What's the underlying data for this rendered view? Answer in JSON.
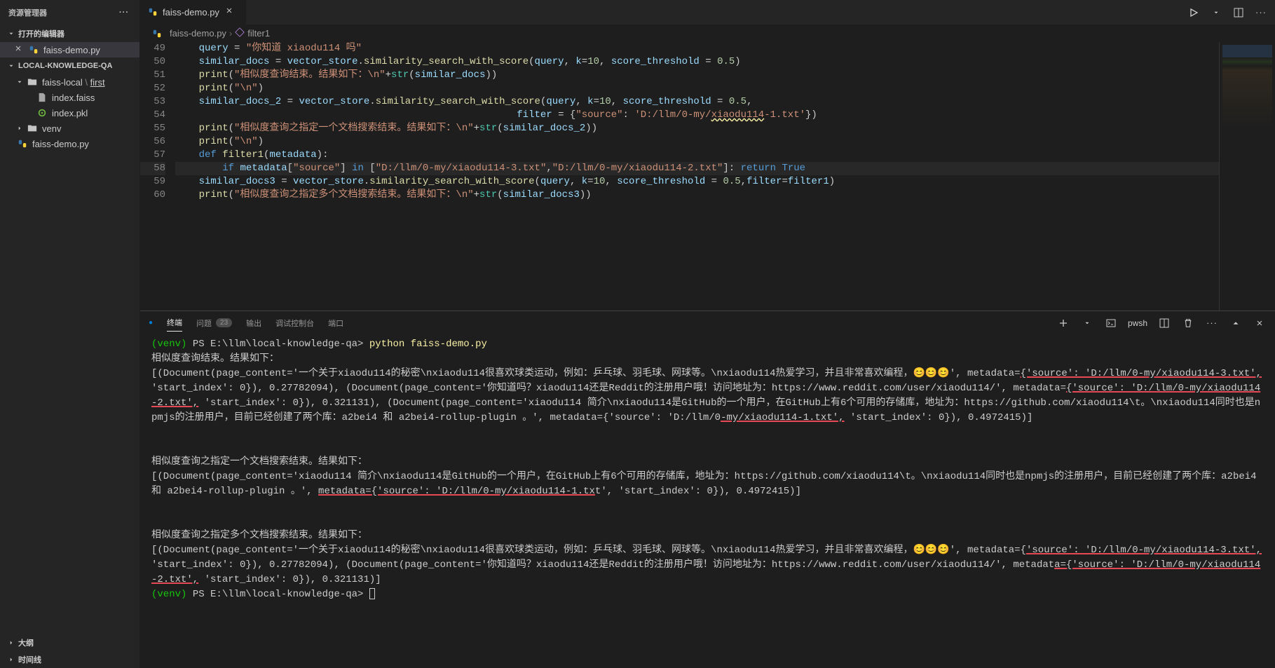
{
  "sidebar": {
    "title": "资源管理器",
    "open_editors": {
      "label": "打开的编辑器",
      "items": [
        {
          "name": "faiss-demo.py"
        }
      ]
    },
    "workspace_label": "LOCAL-KNOWLEDGE-QA",
    "tree": {
      "folder1": "faiss-local",
      "folder1_path_suffix": "first",
      "file1": "index.faiss",
      "file2": "index.pkl",
      "folder2": "venv",
      "file3": "faiss-demo.py"
    },
    "outline_label": "大纲",
    "timeline_label": "时间线"
  },
  "tabs": {
    "tab1": "faiss-demo.py"
  },
  "breadcrumb": {
    "part1": "faiss-demo.py",
    "part2": "filter1"
  },
  "editor": {
    "line_numbers": [
      "49",
      "50",
      "51",
      "52",
      "53",
      "54",
      "55",
      "56",
      "57",
      "58",
      "59",
      "60"
    ],
    "code_html": [
      "    <span class='tk-var'>query</span> <span class='tk-op'>=</span> <span class='tk-str'>\"你知道 xiaodu114 吗\"</span>",
      "    <span class='tk-var'>similar_docs</span> <span class='tk-op'>=</span> <span class='tk-var'>vector_store</span>.<span class='tk-fn'>similarity_search_with_score</span>(<span class='tk-var'>query</span>, <span class='tk-param'>k</span><span class='tk-op'>=</span><span class='tk-num'>10</span>, <span class='tk-param'>score_threshold</span> <span class='tk-op'>=</span> <span class='tk-num'>0.5</span>)",
      "    <span class='tk-fn'>print</span>(<span class='tk-str'>\"相似度查询结束。结果如下：\\n\"</span><span class='tk-op'>+</span><span class='tk-cls'>str</span>(<span class='tk-var'>similar_docs</span>))",
      "    <span class='tk-fn'>print</span>(<span class='tk-str'>\"\\n\"</span>)",
      "    <span class='tk-var'>similar_docs_2</span> <span class='tk-op'>=</span> <span class='tk-var'>vector_store</span>.<span class='tk-fn'>similarity_search_with_score</span>(<span class='tk-var'>query</span>, <span class='tk-param'>k</span><span class='tk-op'>=</span><span class='tk-num'>10</span>, <span class='tk-param'>score_threshold</span> <span class='tk-op'>=</span> <span class='tk-num'>0.5</span>,",
      "                                                          <span class='tk-param'>filter</span> <span class='tk-op'>=</span> {<span class='tk-str'>\"source\"</span>: <span class='tk-str'>'D:/llm/0-my/<span class='wavy'>xiaodu114</span>-1.txt'</span>})",
      "    <span class='tk-fn'>print</span>(<span class='tk-str'>\"相似度查询之指定一个文档搜索结束。结果如下：\\n\"</span><span class='tk-op'>+</span><span class='tk-cls'>str</span>(<span class='tk-var'>similar_docs_2</span>))",
      "    <span class='tk-fn'>print</span>(<span class='tk-str'>\"\\n\"</span>)",
      "    <span class='tk-def'>def</span> <span class='tk-fn'>filter1</span>(<span class='tk-param'>metadata</span>):",
      "        <span class='tk-kw'>if</span> <span class='tk-var'>metadata</span>[<span class='tk-str'>\"source\"</span>] <span class='tk-kw'>in</span> [<span class='tk-str'>\"D:/llm/0-my/xiaodu114-3.txt\"</span>,<span class='tk-str'>\"D:/llm/0-my/xiaodu114-2.txt\"</span>]: <span class='tk-kw'>return</span> <span class='tk-const'>True</span>",
      "    <span class='tk-var'>similar_docs3</span> <span class='tk-op'>=</span> <span class='tk-var'>vector_store</span>.<span class='tk-fn'>similarity_search_with_score</span>(<span class='tk-var'>query</span>, <span class='tk-param'>k</span><span class='tk-op'>=</span><span class='tk-num'>10</span>, <span class='tk-param'>score_threshold</span> <span class='tk-op'>=</span> <span class='tk-num'>0.5</span>,<span class='tk-param'>filter</span><span class='tk-op'>=</span><span class='tk-var'>filter1</span>)",
      "    <span class='tk-fn'>print</span>(<span class='tk-str'>\"相似度查询之指定多个文档搜索结束。结果如下：\\n\"</span><span class='tk-op'>+</span><span class='tk-cls'>str</span>(<span class='tk-var'>similar_docs3</span>))"
    ]
  },
  "panel": {
    "tabs": {
      "terminal": "终端",
      "problems": "问题",
      "problems_count": "23",
      "output": "输出",
      "debug_console": "调试控制台",
      "ports": "端口"
    },
    "shell": "pwsh"
  },
  "terminal": {
    "prompt_prefix": "(venv) ",
    "prompt_path": "PS E:\\llm\\local-knowledge-qa> ",
    "command": "python faiss-demo.py",
    "block1_title": "相似度查询结束。结果如下：",
    "block1_body_a": "[(Document(page_content='一个关于xiaodu114的秘密\\nxiaodu114很喜欢球类运动，例如：乒乓球、羽毛球、网球等。\\nxiaodu114热爱学习，并且非常喜欢编程，😊😊😊', metadata=",
    "block1_src1": "{'source': 'D:/llm/0-my/xiaodu114-3.txt',",
    "block1_body_b": " 'start_index': 0}), 0.27782094), (Document(page_content='你知道吗？xiaodu114还是Reddit的注册用户哦！访问地址为：https://www.reddit.com/user/xiaodu114/', metadata=",
    "block1_src2": "{'source': 'D:/llm/0-my/xiaodu114-2.txt',",
    "block1_body_c": " 'start_index': 0}), 0.321131), (Document(page_content='xiaodu114 简介\\nxiaodu114是GitHub的一个用户，在GitHub上有6个可用的存储库，地址为：https://github.com/xiaodu114\\t。\\nxiaodu114同时也是npmjs的注册用户，目前已经创建了两个库：a2bei4 和 a2bei4-rollup-plugin 。', metadata={'source': 'D:/llm/0",
    "block1_src3": "-my/xiaodu114-1.txt',",
    "block1_body_d": " 'start_index': 0}), 0.4972415)]",
    "block2_title": "相似度查询之指定一个文档搜索结束。结果如下：",
    "block2_body_a": "[(Document(page_content='xiaodu114 简介\\nxiaodu114是GitHub的一个用户，在GitHub上有6个可用的存储库，地址为：https://github.com/xiaodu114\\t。\\nxiaodu114同时也是npmjs的注册用户，目前已经创建了两个库：a2bei4 和 a2bei4-rollup-plugin 。', ",
    "block2_src1": "metadata={'source': 'D:/llm/0-my/xiaodu114-1.tx",
    "block2_body_b": "t', 'start_index': 0}), 0.4972415)]",
    "block3_title": "相似度查询之指定多个文档搜索结束。结果如下：",
    "block3_body_a": "[(Document(page_content='一个关于xiaodu114的秘密\\nxiaodu114很喜欢球类运动，例如：乒乓球、羽毛球、网球等。\\nxiaodu114热爱学习，并且非常喜欢编程，😊😊😊', metadata={",
    "block3_src1": "'source': 'D:/llm/0-my/xiaodu114-3.txt',",
    "block3_body_b": " 'start_index': 0}), 0.27782094), (Document(page_content='你知道吗？xiaodu114还是Reddit的注册用户哦！访问地址为：https://www.reddit.com/user/xiaodu114/', metadat",
    "block3_src2": "a={'source': 'D:/llm/0-my/xiaodu114-2.txt',",
    "block3_body_c": " 'start_index': 0}), 0.321131)]"
  }
}
